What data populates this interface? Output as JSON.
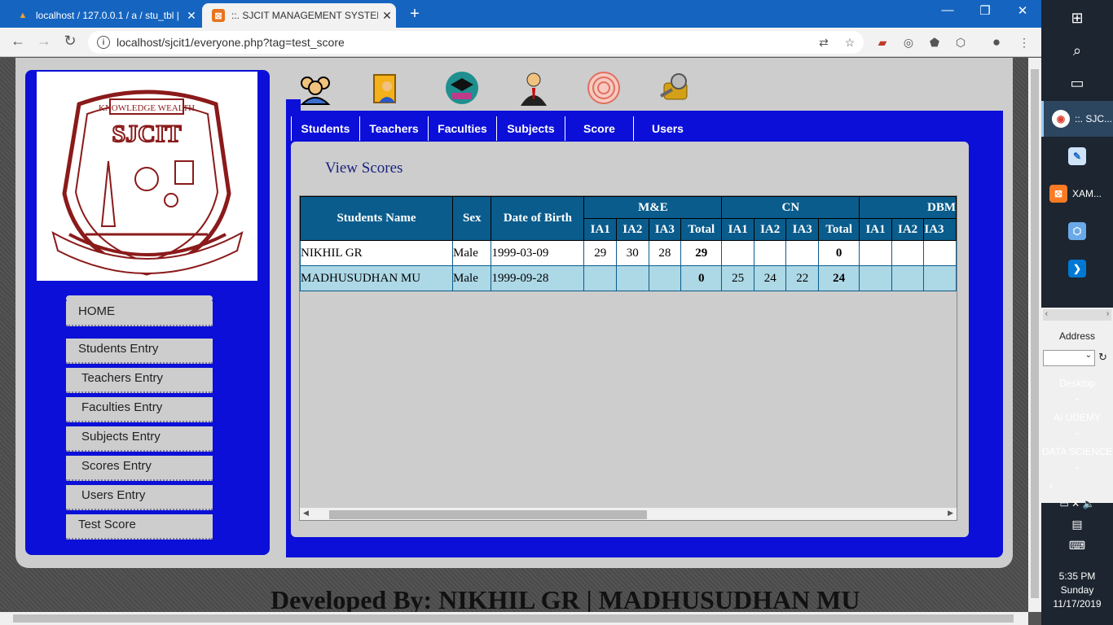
{
  "browser": {
    "tabs": [
      {
        "title": "localhost / 127.0.0.1 / a / stu_tbl | ..."
      },
      {
        "title": "::. SJCIT MANAGEMENT SYSTEM ::."
      }
    ],
    "url": "localhost/sjcit1/everyone.php?tag=test_score"
  },
  "sidebar": {
    "menu": [
      {
        "label": "HOME"
      },
      {
        "label": "Students Entry"
      },
      {
        "label": "Teachers Entry"
      },
      {
        "label": "Faculties Entry"
      },
      {
        "label": "Subjects Entry"
      },
      {
        "label": "Scores Entry"
      },
      {
        "label": "Users Entry"
      },
      {
        "label": "Test Score"
      }
    ]
  },
  "top_icons": [
    "students-icon",
    "teacher-icon",
    "faculties-icon",
    "subjects-icon",
    "score-icon",
    "users-icon"
  ],
  "nav_tabs": [
    "Students",
    "Teachers",
    "Faculties",
    "Subjects",
    "Score",
    "Users"
  ],
  "content": {
    "heading": "View Scores",
    "table": {
      "headers": {
        "name": "Students Name",
        "sex": "Sex",
        "dob": "Date of Birth",
        "subjects": [
          "M&E",
          "CN",
          "DBM"
        ],
        "sub_cols": [
          "IA1",
          "IA2",
          "IA3",
          "Total"
        ]
      },
      "rows": [
        {
          "name": "NIKHIL GR",
          "sex": "Male",
          "dob": "1999-03-09",
          "me": [
            "29",
            "30",
            "28",
            "29"
          ],
          "cn": [
            "",
            "",
            "",
            "0"
          ],
          "dbm": [
            "",
            "",
            ""
          ]
        },
        {
          "name": "MADHUSUDHAN MU",
          "sex": "Male",
          "dob": "1999-09-28",
          "me": [
            "",
            "",
            "",
            "0"
          ],
          "cn": [
            "25",
            "24",
            "22",
            "24"
          ],
          "dbm": [
            "",
            "",
            ""
          ]
        }
      ]
    }
  },
  "footer": "Developed By: NIKHIL GR | MADHUSUDHAN MU",
  "taskbar": {
    "apps": [
      {
        "label": "::. SJC...",
        "icon": "chrome-icon"
      },
      {
        "label": "",
        "icon": "paint-icon"
      },
      {
        "label": "XAM...",
        "icon": "xampp-icon"
      },
      {
        "label": "",
        "icon": "3d-cube-icon"
      },
      {
        "label": "",
        "icon": "vscode-icon"
      }
    ],
    "address_label": "Address",
    "toolbars": [
      "Desktop",
      "AI UDEMY",
      "DATA SCIENCE"
    ],
    "time": "5:35 PM",
    "day": "Sunday",
    "date": "11/17/2019"
  }
}
